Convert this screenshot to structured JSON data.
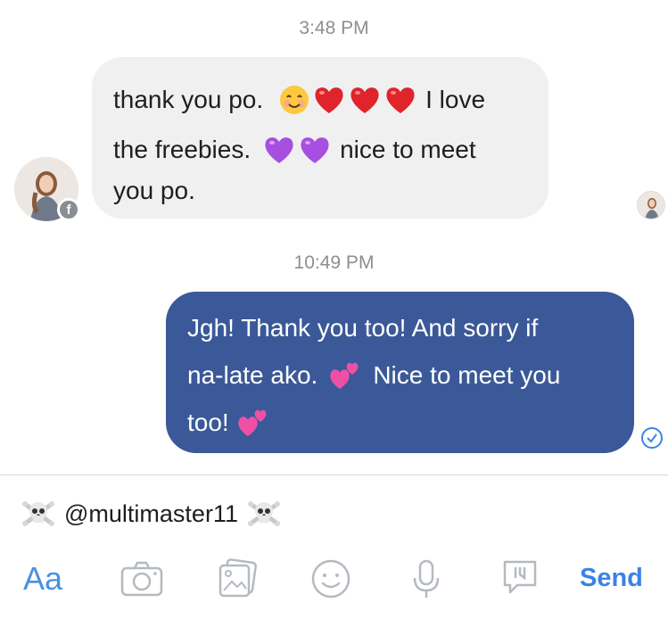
{
  "messages": {
    "first_time": "3:48 PM",
    "incoming": {
      "line1_a": "thank you po.",
      "line1_b": "I love",
      "line2_a": "the freebies.",
      "line2_b": "nice to meet",
      "line3": "you po."
    },
    "second_time": "10:49 PM",
    "outgoing": {
      "line1": "Jgh! Thank you too! And sorry if",
      "line2_a": "na-late ako.",
      "line2_b": "Nice to meet you",
      "line3": "too!"
    }
  },
  "composer": {
    "text": "@multimaster11"
  },
  "toolbar": {
    "text_label": "Aa",
    "send_label": "Send"
  },
  "colors": {
    "outgoing_bubble": "#3b5998",
    "incoming_bubble": "#f1f0f0",
    "accent": "#3b82e6"
  },
  "icons": [
    "camera-icon",
    "gallery-icon",
    "smiley-icon",
    "microphone-icon",
    "like-flag-icon"
  ]
}
